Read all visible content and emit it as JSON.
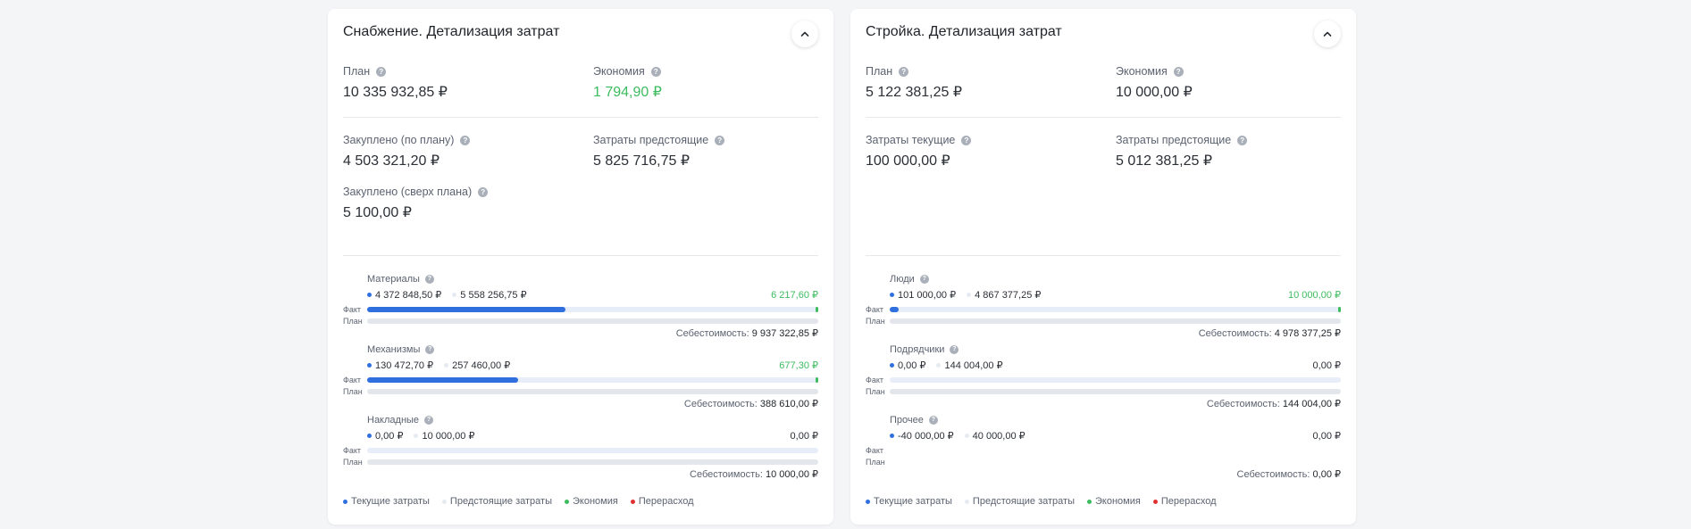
{
  "cards": [
    {
      "title": "Снабжение. Детализация затрат",
      "metrics": [
        {
          "label": "План",
          "value": "10 335 932,85 ₽",
          "green": false
        },
        {
          "label": "Экономия",
          "value": "1 794,90 ₽",
          "green": true
        },
        {
          "label": "Закуплено (по плану)",
          "value": "4 503 321,20 ₽",
          "green": false
        },
        {
          "label": "Затраты предстоящие",
          "value": "5 825 716,75 ₽",
          "green": false
        },
        {
          "label": "Закуплено (сверх плана)",
          "value": "5 100,00 ₽",
          "green": false
        }
      ],
      "categories": [
        {
          "name": "Материалы",
          "current": "4 372 848,50 ₽",
          "upcoming": "5 558 256,75 ₽",
          "economy": "6 217,60 ₽",
          "economy_green": true,
          "fact_label": "Факт",
          "plan_label": "План",
          "fact_fraction": 0.44,
          "cost_label": "Себестоимость:",
          "cost": "9 937 322,85 ₽"
        },
        {
          "name": "Механизмы",
          "current": "130 472,70 ₽",
          "upcoming": "257 460,00 ₽",
          "economy": "677,30 ₽",
          "economy_green": true,
          "fact_label": "Факт",
          "plan_label": "План",
          "fact_fraction": 0.335,
          "cost_label": "Себестоимость:",
          "cost": "388 610,00 ₽"
        },
        {
          "name": "Накладные",
          "current": "0,00 ₽",
          "upcoming": "10 000,00 ₽",
          "economy": "0,00 ₽",
          "economy_green": false,
          "fact_label": "Факт",
          "plan_label": "План",
          "fact_fraction": 0,
          "cost_label": "Себестоимость:",
          "cost": "10 000,00 ₽"
        }
      ]
    },
    {
      "title": "Стройка. Детализация затрат",
      "metrics": [
        {
          "label": "План",
          "value": "5 122 381,25 ₽",
          "green": false
        },
        {
          "label": "Экономия",
          "value": "10 000,00 ₽",
          "green": false
        },
        {
          "label": "Затраты текущие",
          "value": "100 000,00 ₽",
          "green": false
        },
        {
          "label": "Затраты предстоящие",
          "value": "5 012 381,25 ₽",
          "green": false
        }
      ],
      "categories": [
        {
          "name": "Люди",
          "current": "101 000,00 ₽",
          "upcoming": "4 867 377,25 ₽",
          "economy": "10 000,00 ₽",
          "economy_green": true,
          "fact_label": "Факт",
          "plan_label": "План",
          "fact_fraction": 0.02,
          "cost_label": "Себестоимость:",
          "cost": "4 978 377,25 ₽"
        },
        {
          "name": "Подрядчики",
          "current": "0,00 ₽",
          "upcoming": "144 004,00 ₽",
          "economy": "0,00 ₽",
          "economy_green": false,
          "fact_label": "Факт",
          "plan_label": "План",
          "fact_fraction": 0,
          "cost_label": "Себестоимость:",
          "cost": "144 004,00 ₽"
        },
        {
          "name": "Прочее",
          "current": "-40 000,00 ₽",
          "upcoming": "40 000,00 ₽",
          "economy": "0,00 ₽",
          "economy_green": false,
          "fact_label": "Факт",
          "plan_label": "План",
          "fact_fraction": 0,
          "cost_label": "Себестоимость:",
          "cost": "0,00 ₽"
        }
      ]
    }
  ],
  "legend": {
    "current": "Текущие затраты",
    "upcoming": "Предстоящие затраты",
    "economy": "Экономия",
    "overspend": "Перерасход"
  },
  "colors": {
    "accent": "#2f6fde",
    "economy": "#3dbb5f",
    "overspend": "#e03131",
    "upcoming": "#e6ebf2"
  },
  "icons": {
    "help": "question-circle-icon",
    "collapse": "chevron-up-icon"
  },
  "help_glyph": "?"
}
